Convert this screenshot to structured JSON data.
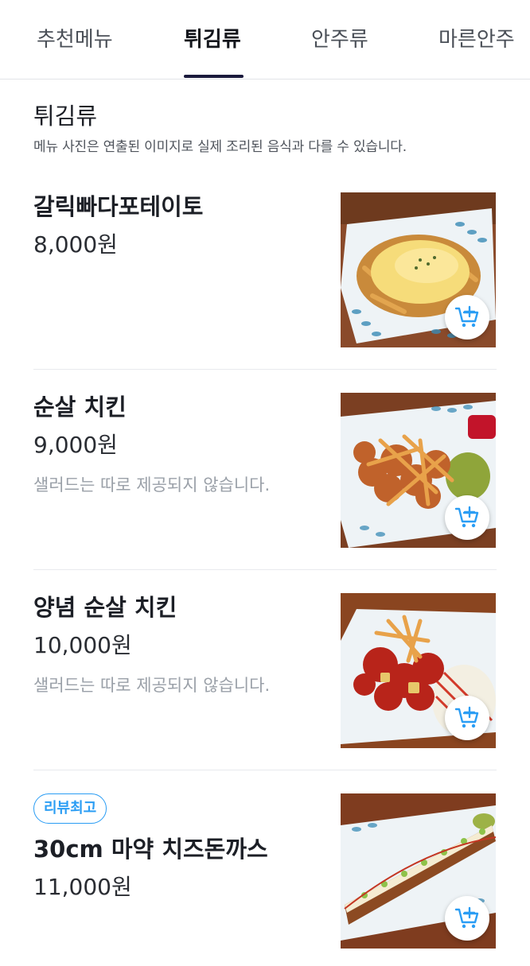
{
  "tabs": [
    {
      "label": "추천메뉴",
      "active": false
    },
    {
      "label": "튀김류",
      "active": true
    },
    {
      "label": "안주류",
      "active": false
    },
    {
      "label": "마른안주",
      "active": false
    }
  ],
  "section": {
    "title": "튀김류",
    "note": "메뉴 사진은 연출된 이미지로 실제 조리된 음식과 다를 수 있습니다."
  },
  "items": [
    {
      "name": "갈릭빠다포테이토",
      "price": "8,000원",
      "description": "",
      "badge": "",
      "image_icon": "cheese-fries-photo"
    },
    {
      "name": "순살 치킨",
      "price": "9,000원",
      "description": "샐러드는 따로 제공되지 않습니다.",
      "badge": "",
      "image_icon": "fried-chicken-photo"
    },
    {
      "name": "양념 순살 치킨",
      "price": "10,000원",
      "description": "샐러드는 따로 제공되지 않습니다.",
      "badge": "",
      "image_icon": "seasoned-chicken-photo"
    },
    {
      "name": "30cm 마약 치즈돈까스",
      "price": "11,000원",
      "description": "",
      "badge": "리뷰최고",
      "image_icon": "cheese-tonkatsu-photo"
    }
  ],
  "colors": {
    "accent": "#2a9df4",
    "tab_indicator": "#1a1a3c",
    "muted_text": "#9aa0a8"
  },
  "icons": {
    "cart_button": "add-to-cart-icon"
  }
}
